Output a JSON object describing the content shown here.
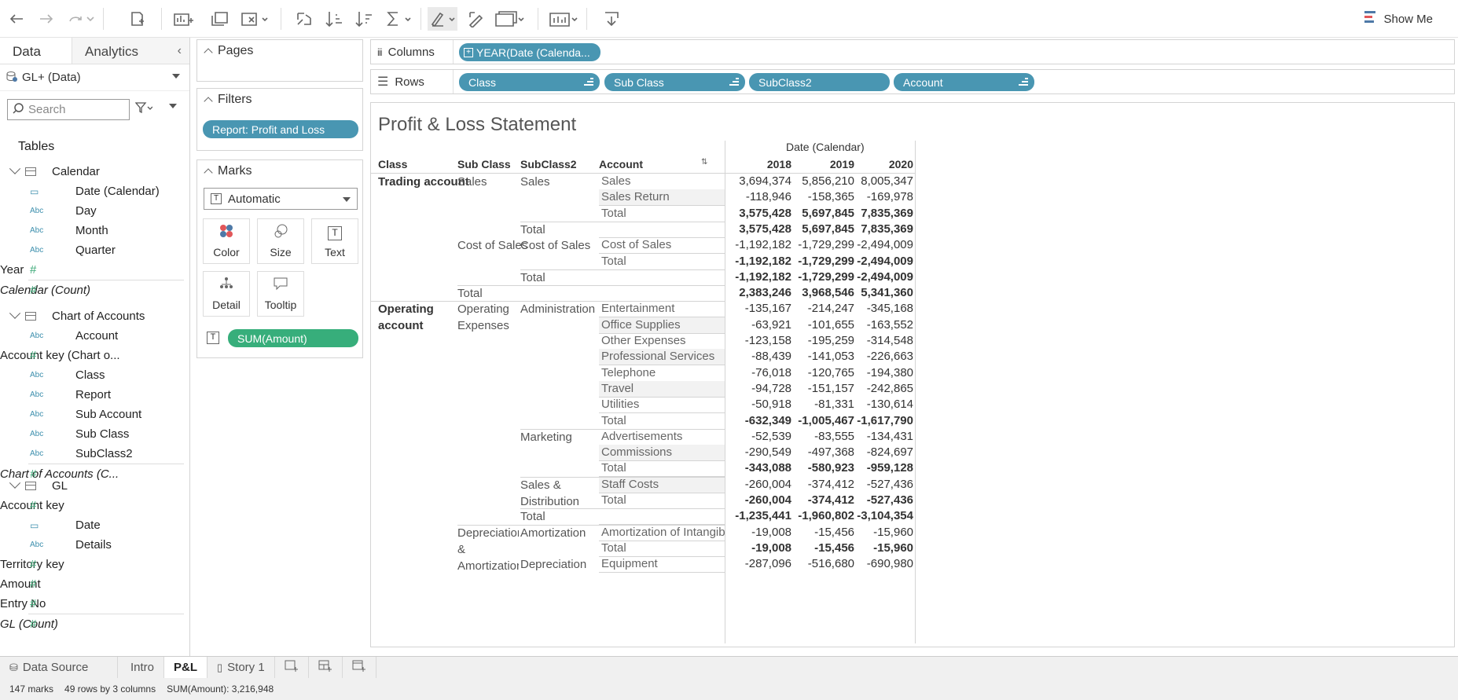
{
  "toolbar": {
    "show_me": "Show Me"
  },
  "left_panel": {
    "tab_data": "Data",
    "tab_analytics": "Analytics",
    "datasource": "GL+ (Data)",
    "search_placeholder": "Search",
    "tables_label": "Tables",
    "groups": [
      {
        "name": "Calendar",
        "fields": [
          {
            "type": "cal",
            "glyph": "▭",
            "name": "Date (Calendar)"
          },
          {
            "type": "abc",
            "glyph": "Abc",
            "name": "Day"
          },
          {
            "type": "abc",
            "glyph": "Abc",
            "name": "Month"
          },
          {
            "type": "abc",
            "glyph": "Abc",
            "name": "Quarter"
          },
          {
            "type": "num",
            "glyph": "#",
            "name": "Year"
          },
          {
            "type": "num",
            "glyph": "#",
            "name": "Calendar (Count)",
            "italic": true
          }
        ]
      },
      {
        "name": "Chart of Accounts",
        "fields": [
          {
            "type": "abc",
            "glyph": "Abc",
            "name": "Account"
          },
          {
            "type": "num",
            "glyph": "#",
            "name": "Account key (Chart o..."
          },
          {
            "type": "abc",
            "glyph": "Abc",
            "name": "Class"
          },
          {
            "type": "abc",
            "glyph": "Abc",
            "name": "Report"
          },
          {
            "type": "abc",
            "glyph": "Abc",
            "name": "Sub Account"
          },
          {
            "type": "abc",
            "glyph": "Abc",
            "name": "Sub Class"
          },
          {
            "type": "abc",
            "glyph": "Abc",
            "name": "SubClass2"
          },
          {
            "type": "num",
            "glyph": "#",
            "name": "Chart of Accounts (C...",
            "italic": true
          }
        ]
      },
      {
        "name": "GL",
        "fields": [
          {
            "type": "num",
            "glyph": "#",
            "name": "Account key"
          },
          {
            "type": "cal",
            "glyph": "▭",
            "name": "Date"
          },
          {
            "type": "abc",
            "glyph": "Abc",
            "name": "Details"
          },
          {
            "type": "num",
            "glyph": "#",
            "name": "Territory key"
          },
          {
            "type": "num",
            "glyph": "#",
            "name": "Amount"
          },
          {
            "type": "num",
            "glyph": "#",
            "name": "Entry No"
          },
          {
            "type": "num",
            "glyph": "#",
            "name": "GL (Count)",
            "italic": true
          }
        ]
      }
    ]
  },
  "cards": {
    "pages": "Pages",
    "filters": "Filters",
    "filter_pill": "Report: Profit and Loss",
    "marks": "Marks",
    "marks_type": "Automatic",
    "mark_buttons": [
      "Color",
      "Size",
      "Text",
      "Detail",
      "Tooltip"
    ],
    "measure_pill": "SUM(Amount)"
  },
  "shelves": {
    "columns_label": "Columns",
    "columns_pill": "YEAR(Date (Calenda...",
    "rows_label": "Rows",
    "rows_pills": [
      "Class",
      "Sub Class",
      "SubClass2",
      "Account"
    ]
  },
  "sheet": {
    "title": "Profit & Loss Statement",
    "date_header": "Date (Calendar)",
    "headers": [
      "Class",
      "Sub Class",
      "SubClass2",
      "Account"
    ],
    "years": [
      "2018",
      "2019",
      "2020"
    ],
    "class_labels": [
      "Trading account",
      "Operating account"
    ],
    "sub_class_labels": [
      "Sales",
      "Cost of Sales",
      "Total",
      "Operating Expenses",
      "Depreciation & Amortization"
    ],
    "subclass2_labels": [
      "Sales",
      "Total",
      "Cost of Sales",
      "Total",
      "Administration",
      "Marketing",
      "Sales & Distribution",
      "Total",
      "Amortization",
      "Depreciation"
    ],
    "rows": [
      {
        "account": "Sales",
        "v": [
          "3,694,374",
          "5,856,210",
          "8,005,347"
        ]
      },
      {
        "account": "Sales Return",
        "v": [
          "-118,946",
          "-158,365",
          "-169,978"
        ]
      },
      {
        "account": "Total",
        "v": [
          "3,575,428",
          "5,697,845",
          "7,835,369"
        ],
        "total": true
      },
      {
        "account": "",
        "v": [
          "3,575,428",
          "5,697,845",
          "7,835,369"
        ],
        "total": true
      },
      {
        "account": "Cost of Sales",
        "v": [
          "-1,192,182",
          "-1,729,299",
          "-2,494,009"
        ]
      },
      {
        "account": "Total",
        "v": [
          "-1,192,182",
          "-1,729,299",
          "-2,494,009"
        ],
        "total": true
      },
      {
        "account": "",
        "v": [
          "-1,192,182",
          "-1,729,299",
          "-2,494,009"
        ],
        "total": true
      },
      {
        "account": "",
        "v": [
          "2,383,246",
          "3,968,546",
          "5,341,360"
        ],
        "total": true
      },
      {
        "account": "Entertainment",
        "v": [
          "-135,167",
          "-214,247",
          "-345,168"
        ]
      },
      {
        "account": "Office Supplies",
        "v": [
          "-63,921",
          "-101,655",
          "-163,552"
        ]
      },
      {
        "account": "Other Expenses",
        "v": [
          "-123,158",
          "-195,259",
          "-314,548"
        ]
      },
      {
        "account": "Professional Services",
        "v": [
          "-88,439",
          "-141,053",
          "-226,663"
        ]
      },
      {
        "account": "Telephone",
        "v": [
          "-76,018",
          "-120,765",
          "-194,380"
        ]
      },
      {
        "account": "Travel",
        "v": [
          "-94,728",
          "-151,157",
          "-242,865"
        ]
      },
      {
        "account": "Utilities",
        "v": [
          "-50,918",
          "-81,331",
          "-130,614"
        ]
      },
      {
        "account": "Total",
        "v": [
          "-632,349",
          "-1,005,467",
          "-1,617,790"
        ],
        "total": true
      },
      {
        "account": "Advertisements",
        "v": [
          "-52,539",
          "-83,555",
          "-134,431"
        ]
      },
      {
        "account": "Commissions",
        "v": [
          "-290,549",
          "-497,368",
          "-824,697"
        ]
      },
      {
        "account": "Total",
        "v": [
          "-343,088",
          "-580,923",
          "-959,128"
        ],
        "total": true
      },
      {
        "account": "Staff Costs",
        "v": [
          "-260,004",
          "-374,412",
          "-527,436"
        ]
      },
      {
        "account": "Total",
        "v": [
          "-260,004",
          "-374,412",
          "-527,436"
        ],
        "total": true
      },
      {
        "account": "",
        "v": [
          "-1,235,441",
          "-1,960,802",
          "-3,104,354"
        ],
        "total": true
      },
      {
        "account": "Amortization of Intangibl...",
        "v": [
          "-19,008",
          "-15,456",
          "-15,960"
        ]
      },
      {
        "account": "Total",
        "v": [
          "-19,008",
          "-15,456",
          "-15,960"
        ],
        "total": true
      },
      {
        "account": "Equipment",
        "v": [
          "-287,096",
          "-516,680",
          "-690,980"
        ]
      }
    ]
  },
  "bottom_tabs": [
    "Data Source",
    "Intro",
    "P&L",
    "Story 1"
  ],
  "status": {
    "marks": "147 marks",
    "rows": "49 rows by 3 columns",
    "sum": "SUM(Amount): 3,216,948"
  }
}
